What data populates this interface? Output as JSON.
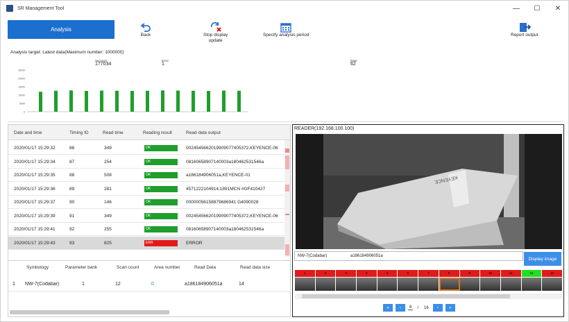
{
  "window": {
    "title": "SR Management Tool",
    "minimize": "—",
    "maximize": "☐",
    "close": "✕"
  },
  "toolbar": {
    "analysis_label": "Analysis",
    "back_label": "Back",
    "stop_label_1": "Stop display",
    "stop_label_2": "update",
    "period_label": "Specify analysis period",
    "report_label": "Report output"
  },
  "analysis_target": "Analysis target: Latest data(Maximum number: 1000000)",
  "stats": {
    "success_caption": "Success",
    "success_value": "177034",
    "error_caption": "Error",
    "error_value": "1",
    "rate_caption": "Rate",
    "rate_value": "62"
  },
  "chart_data": {
    "type": "bar",
    "values": [
      50,
      12000,
      0,
      12600,
      0,
      12800,
      0,
      12500,
      0,
      12700,
      0,
      12600,
      0,
      12500,
      0,
      12600,
      0,
      12800,
      0,
      12700,
      0,
      12600,
      0,
      12500,
      0,
      12700,
      0,
      12600,
      0
    ],
    "ylim": [
      0,
      25000
    ],
    "yticks": [
      "25000",
      "20000",
      "15000",
      "10000",
      "5000",
      "0"
    ],
    "color": "#1f9e2c"
  },
  "grid": {
    "headers": [
      "Date and time",
      "Timing ID",
      "Read time",
      "Reading result",
      "Read data output"
    ],
    "rows": [
      {
        "date": "2020/01/17 15:29:32",
        "timing": "86",
        "read": "349",
        "result": "OK",
        "output": "0024545662019909077405372,KEYENCE-06"
      },
      {
        "date": "2020/01/17 15:29:34",
        "timing": "87",
        "read": "254",
        "result": "OK",
        "output": "08160658907140003a180462531546a"
      },
      {
        "date": "2020/01/17 15:29:35",
        "timing": "88",
        "read": "508",
        "result": "OK",
        "output": "a186184906051a,KEYENCE-01"
      },
      {
        "date": "2020/01/17 15:29:36",
        "timing": "89",
        "read": "281",
        "result": "OK",
        "output": "4571222104914,1891MCN #GF410427"
      },
      {
        "date": "2020/01/17 15:29:37",
        "timing": "90",
        "read": "146",
        "result": "OK",
        "output": "00000056158879686941  G4090028"
      },
      {
        "date": "2020/01/17 15:29:39",
        "timing": "91",
        "read": "349",
        "result": "OK",
        "output": "0024545662019909077405372,KEYENCE-06"
      },
      {
        "date": "2020/01/17 15:29:41",
        "timing": "92",
        "read": "255",
        "result": "OK",
        "output": "08160658907140003a180462531546a"
      },
      {
        "date": "2020/01/17 15:29:43",
        "timing": "93",
        "read": "825",
        "result": "ERR",
        "output": "ERROR"
      }
    ]
  },
  "symbology": {
    "headers": [
      "Symbology",
      "Parameter bank",
      "Scan count",
      "Area number",
      "Read Data",
      "Read data size"
    ],
    "row": {
      "idx": "1",
      "symbology": "NW-7(Codabar)",
      "bank": "1",
      "scan": "12",
      "area": "0",
      "data": "a186184906051a",
      "size": "14"
    }
  },
  "reader": {
    "label": "READER(192.168.100.100)",
    "code_type": "NW-7(Codabar)",
    "code_value": "a186184906051a",
    "display_image_label": "Display image",
    "camera_text": "KEYENCE",
    "indicators": [
      "1",
      "2",
      "3",
      "4",
      "5",
      "6",
      "7",
      "8",
      "9",
      "10",
      "11",
      "12",
      "13"
    ],
    "page_current": "8",
    "page_sep": "/",
    "page_total": "16"
  }
}
